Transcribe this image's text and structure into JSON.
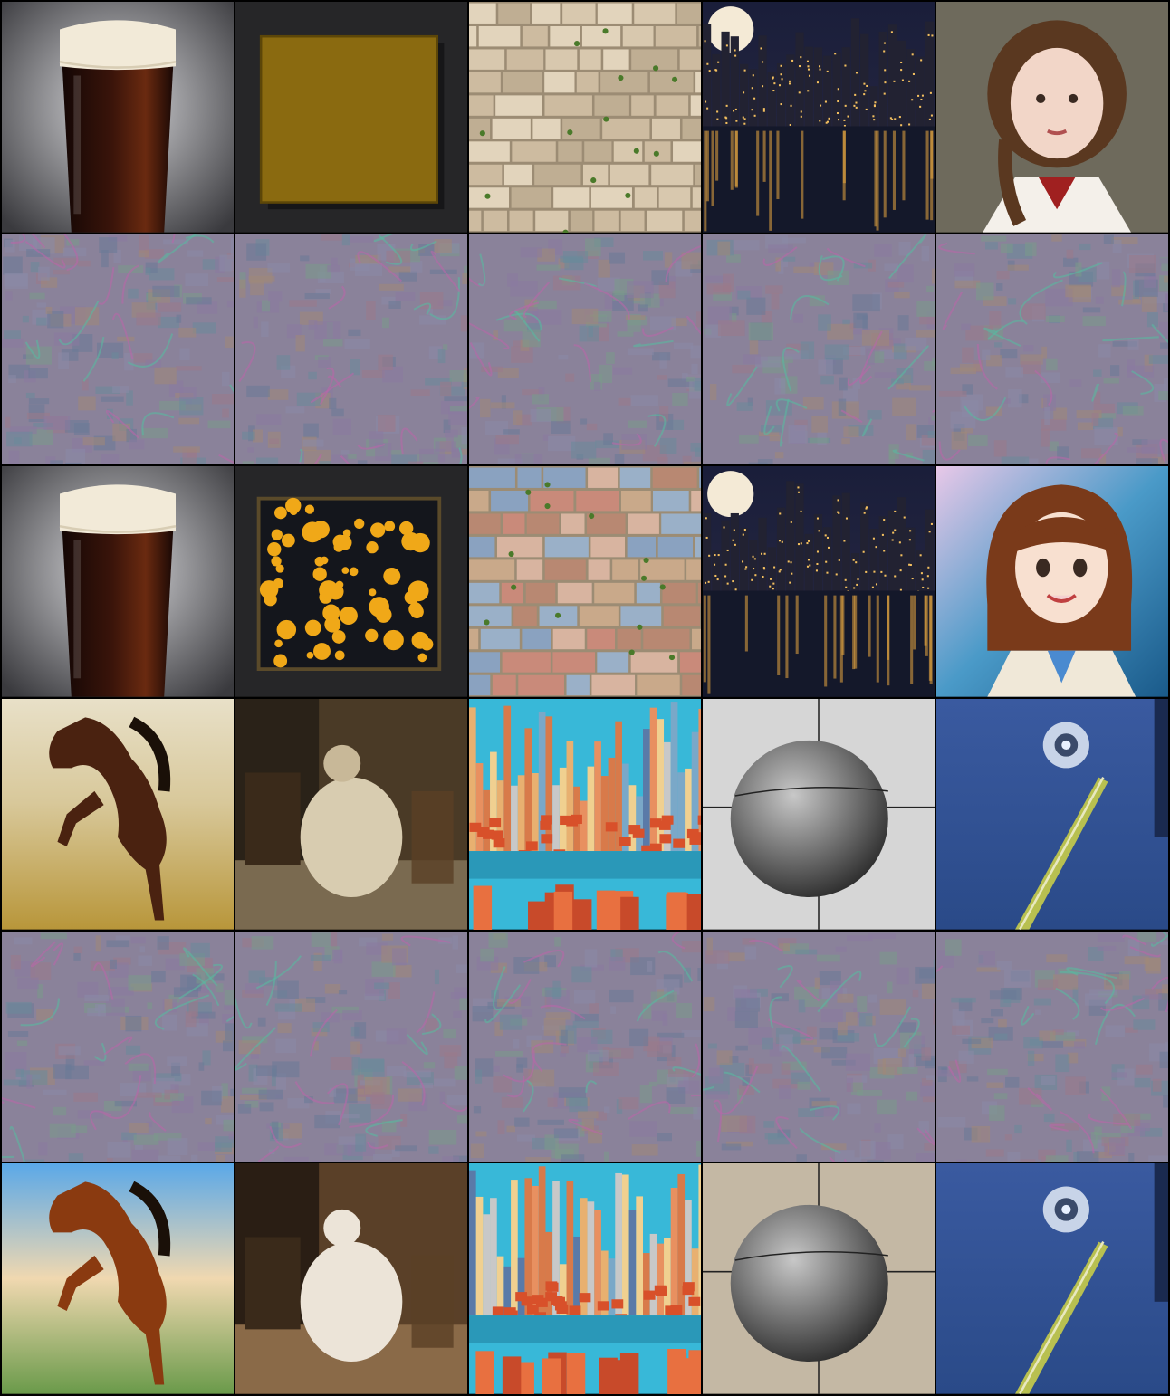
{
  "grid": {
    "rows": 6,
    "cols": 5,
    "cells": [
      {
        "name": "beer-glass-source",
        "kind": "beer",
        "tone": "photo"
      },
      {
        "name": "mustard-square-source",
        "kind": "square",
        "tone": "plain"
      },
      {
        "name": "stone-wall-source",
        "kind": "wall",
        "tone": "beige"
      },
      {
        "name": "night-city-source",
        "kind": "nightcity",
        "tone": "photo"
      },
      {
        "name": "girl-portrait-source",
        "kind": "girl",
        "tone": "painted"
      },
      {
        "name": "noise-beer",
        "kind": "noise",
        "tone": "1"
      },
      {
        "name": "noise-square",
        "kind": "noise",
        "tone": "2"
      },
      {
        "name": "noise-wall",
        "kind": "noise",
        "tone": "3"
      },
      {
        "name": "noise-nightcity",
        "kind": "noise",
        "tone": "4"
      },
      {
        "name": "noise-girl",
        "kind": "noise",
        "tone": "5"
      },
      {
        "name": "beer-glass-result",
        "kind": "beer",
        "tone": "result"
      },
      {
        "name": "flower-square-result",
        "kind": "flowers",
        "tone": "result"
      },
      {
        "name": "brick-wall-result",
        "kind": "wall",
        "tone": "colorful"
      },
      {
        "name": "night-city-result",
        "kind": "nightcity",
        "tone": "result"
      },
      {
        "name": "anime-girl-result",
        "kind": "anime",
        "tone": "result"
      },
      {
        "name": "horse-painting-source",
        "kind": "horse",
        "tone": "plain"
      },
      {
        "name": "sepia-woman-source",
        "kind": "sepia",
        "tone": "sepia"
      },
      {
        "name": "colorful-city-source",
        "kind": "colorcity",
        "tone": "source"
      },
      {
        "name": "sphere-sketch-source",
        "kind": "sphere",
        "tone": "grey"
      },
      {
        "name": "space-station-source",
        "kind": "space",
        "tone": "source"
      },
      {
        "name": "noise-horse",
        "kind": "noise",
        "tone": "6"
      },
      {
        "name": "noise-sepia",
        "kind": "noise",
        "tone": "7"
      },
      {
        "name": "noise-colorcity",
        "kind": "noise",
        "tone": "8"
      },
      {
        "name": "noise-sphere",
        "kind": "noise",
        "tone": "9"
      },
      {
        "name": "noise-space",
        "kind": "noise",
        "tone": "10"
      },
      {
        "name": "anime-horse-result",
        "kind": "horse",
        "tone": "anime"
      },
      {
        "name": "anime-woman-result",
        "kind": "sepia",
        "tone": "anime"
      },
      {
        "name": "colorful-city-result",
        "kind": "colorcity",
        "tone": "result"
      },
      {
        "name": "sphere-sketch-result",
        "kind": "sphere",
        "tone": "beige"
      },
      {
        "name": "space-station-result",
        "kind": "space",
        "tone": "result"
      }
    ]
  }
}
